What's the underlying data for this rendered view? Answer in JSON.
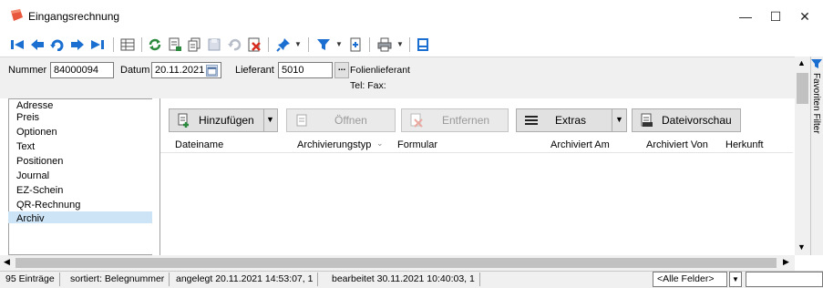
{
  "window": {
    "title": "Eingangsrechnung",
    "controls": {
      "minimize": "—",
      "maximize": "☐",
      "close": "✕"
    }
  },
  "toolbar": {
    "icons": [
      "first-record-icon",
      "previous-record-icon",
      "back-history-icon",
      "next-record-icon",
      "last-record-icon",
      "table-view-icon",
      "refresh-icon",
      "export-icon",
      "copy-icon",
      "save-icon",
      "undo-icon",
      "delete-icon",
      "pin-icon",
      "filter-icon",
      "document-icon",
      "print-icon",
      "exit-icon"
    ]
  },
  "header": {
    "nummer_label": "Nummer",
    "nummer_value": "84000094",
    "datum_label": "Datum",
    "datum_value": "20.11.2021",
    "lieferant_label": "Lieferant",
    "lieferant_value": "5010",
    "lookup_button": "...",
    "lieferant_name": "Folienlieferant",
    "tel_fax": "Tel:  Fax:"
  },
  "nav": {
    "items": [
      "Adresse",
      "Preis",
      "Optionen",
      "Text",
      "Positionen",
      "Journal",
      "EZ-Schein",
      "QR-Rechnung",
      "Archiv"
    ],
    "selected": "Archiv"
  },
  "buttons": {
    "add": "Hinzufügen",
    "open": "Öffnen",
    "remove": "Entfernen",
    "extras": "Extras",
    "preview": "Dateivorschau"
  },
  "grid": {
    "columns": [
      "Dateiname",
      "Archivierungstyp",
      "Formular",
      "Archiviert Am",
      "Archiviert Von",
      "Herkunft"
    ]
  },
  "sidetab": {
    "label": "Favoriten Filter"
  },
  "status": {
    "count": "95 Einträge",
    "sort": "sortiert: Belegnummer",
    "created": "angelegt 20.11.2021 14:53:07, 1",
    "edited": "bearbeitet 30.11.2021 10:40:03, 1",
    "filter_value": "<Alle Felder>"
  },
  "colors": {
    "accent_blue": "#1a6fd1",
    "nav_selected": "#cde4f7",
    "panel_bg": "#f0f0f0"
  }
}
